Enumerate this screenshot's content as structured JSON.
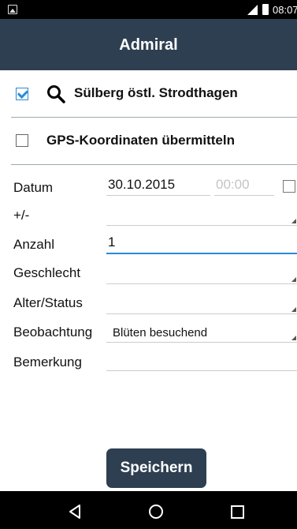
{
  "status": {
    "time": "08:07",
    "icons": [
      "image-icon",
      "signal-icon",
      "battery-icon"
    ]
  },
  "appbar": {
    "title": "Admiral"
  },
  "location": {
    "checked": true,
    "label": "Sülberg östl. Strodthagen",
    "icon": "search-icon"
  },
  "gps": {
    "checked": false,
    "label": "GPS-Koordinaten übermitteln"
  },
  "form": {
    "datum": {
      "label": "Datum",
      "date": "30.10.2015",
      "time_placeholder": "00:00"
    },
    "plusminus": {
      "label": "+/-",
      "value": ""
    },
    "anzahl": {
      "label": "Anzahl",
      "value": "1"
    },
    "geschlecht": {
      "label": "Geschlecht",
      "value": ""
    },
    "alter": {
      "label": "Alter/Status",
      "value": ""
    },
    "beobachtung": {
      "label": "Beobachtung",
      "value": "Blüten besuchend"
    },
    "bemerkung": {
      "label": "Bemerkung",
      "value": ""
    }
  },
  "actions": {
    "save_label": "Speichern"
  },
  "navbar": {
    "icons": [
      "back-icon",
      "home-icon",
      "recents-icon"
    ]
  },
  "colors": {
    "appbar": "#2e3f52",
    "accent": "#2b8ad8"
  }
}
